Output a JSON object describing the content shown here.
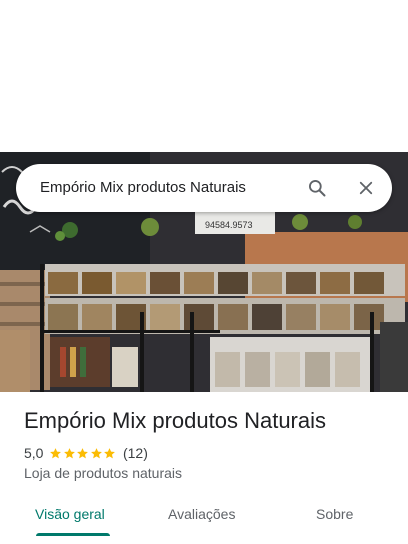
{
  "search": {
    "query": "Empório Mix produtos Naturais",
    "search_icon": "search-icon",
    "close_icon": "close-icon"
  },
  "photo": {
    "storefront_sign": "94584.9573"
  },
  "place": {
    "name": "Empório Mix produtos Naturais",
    "rating": "5,0",
    "stars": 5,
    "review_count": "(12)",
    "category": "Loja de produtos naturais"
  },
  "tabs": [
    {
      "label": "Visão geral",
      "active": true
    },
    {
      "label": "Avaliações",
      "active": false
    },
    {
      "label": "Sobre",
      "active": false
    }
  ],
  "colors": {
    "accent": "#00796b",
    "star": "#fbbc04"
  }
}
